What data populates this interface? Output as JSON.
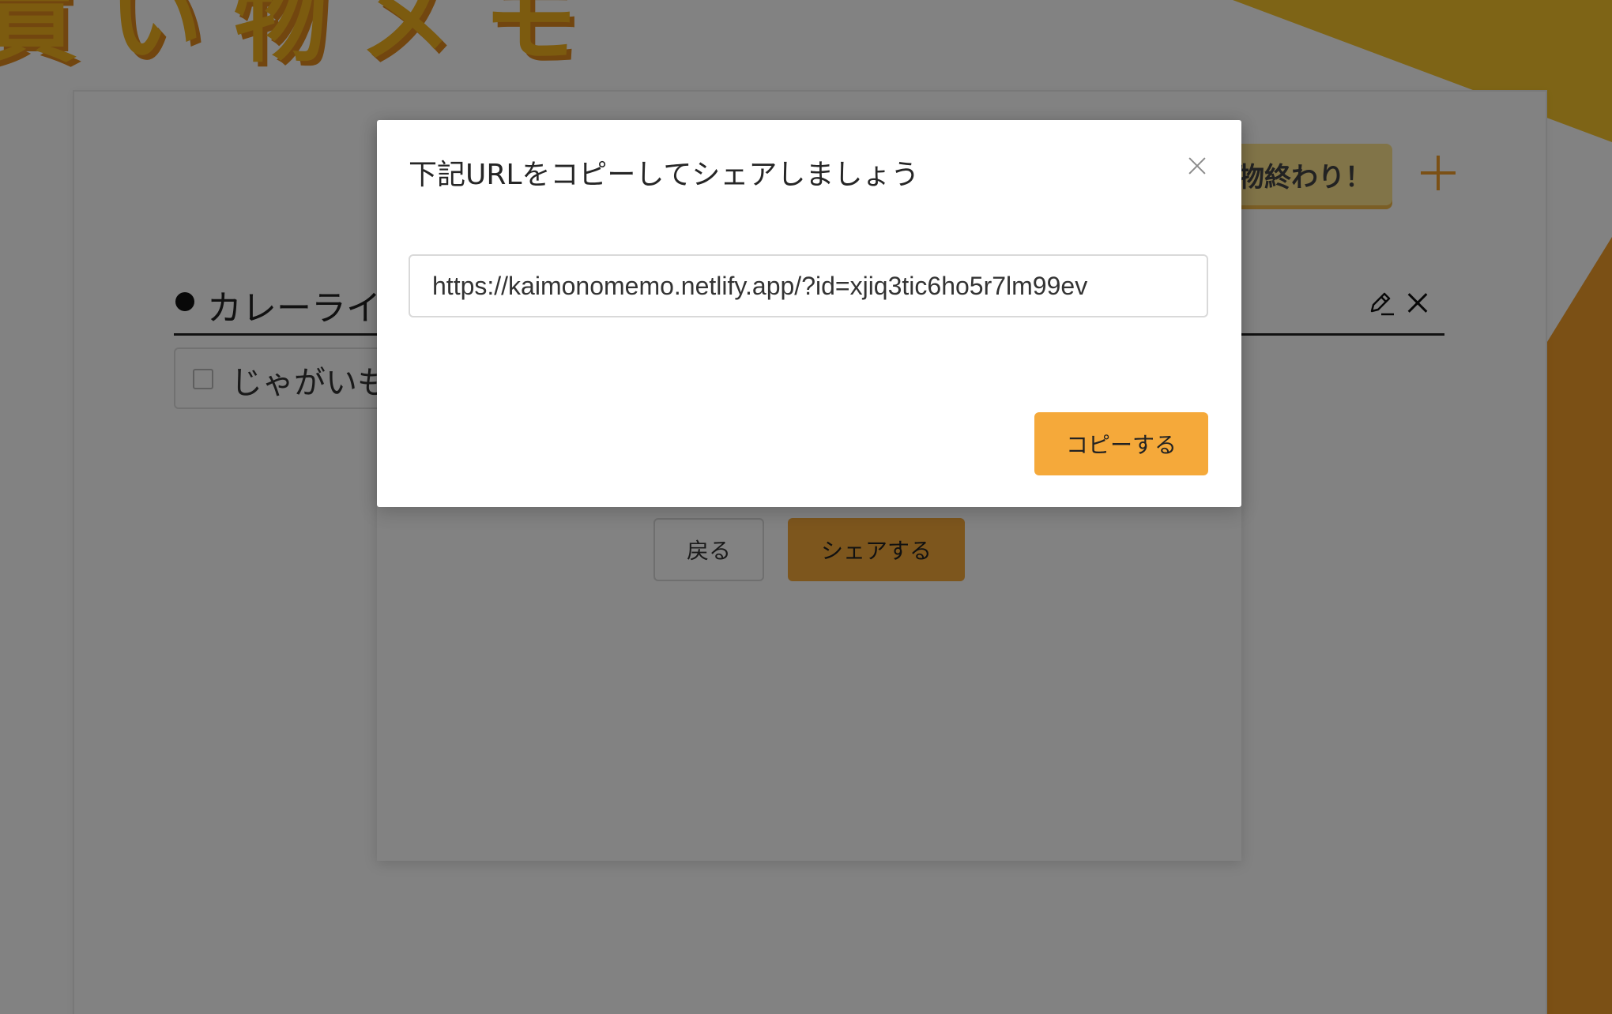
{
  "app": {
    "logo_text": "買い物メモ"
  },
  "header": {
    "done_button_label": "物終わり！",
    "add_button": "plus-icon"
  },
  "list": {
    "title": "カレーライ",
    "edit_icon": "pencil-icon",
    "delete_icon": "close-icon",
    "items": [
      {
        "label": "じゃがいも",
        "checked": false
      }
    ]
  },
  "share_modal": {
    "back_label": "戻る",
    "share_label": "シェアする"
  },
  "url_dialog": {
    "title": "下記URLをコピーしてシェアしましょう",
    "url": "https://kaimonomemo.netlify.app/?id=xjiq3tic6ho5r7lm99ev",
    "copy_label": "コピーする",
    "close_icon": "close-icon"
  },
  "colors": {
    "accent": "#f5a93a",
    "logo": "#f3b21f",
    "done_button": "#fde38e"
  }
}
